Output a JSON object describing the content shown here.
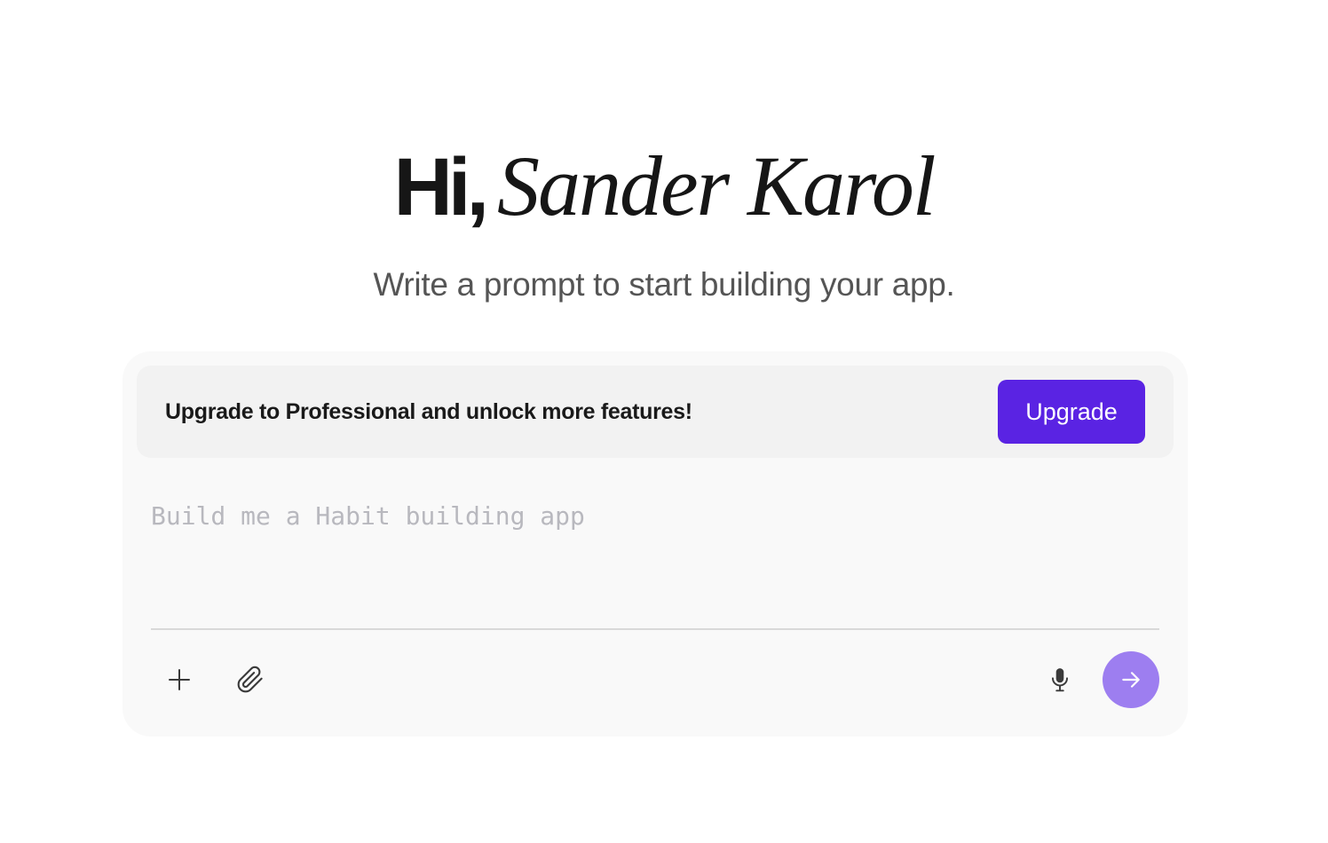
{
  "greeting": {
    "prefix": "Hi,",
    "name": "Sander Karol"
  },
  "subtitle": "Write a prompt to start building your app.",
  "banner": {
    "message": "Upgrade to Professional and unlock more features!",
    "button_label": "Upgrade"
  },
  "composer": {
    "placeholder": "Build me a Habit building app",
    "value": "",
    "icons": {
      "add": "plus-icon",
      "attach": "paperclip-icon",
      "voice": "microphone-icon",
      "send": "arrow-right-icon"
    }
  },
  "colors": {
    "accent": "#5a23e3",
    "send_button": "#9d7ef0",
    "composer_bg": "#f9f9f9",
    "banner_bg": "#f2f2f2",
    "placeholder": "#b8b8be"
  }
}
